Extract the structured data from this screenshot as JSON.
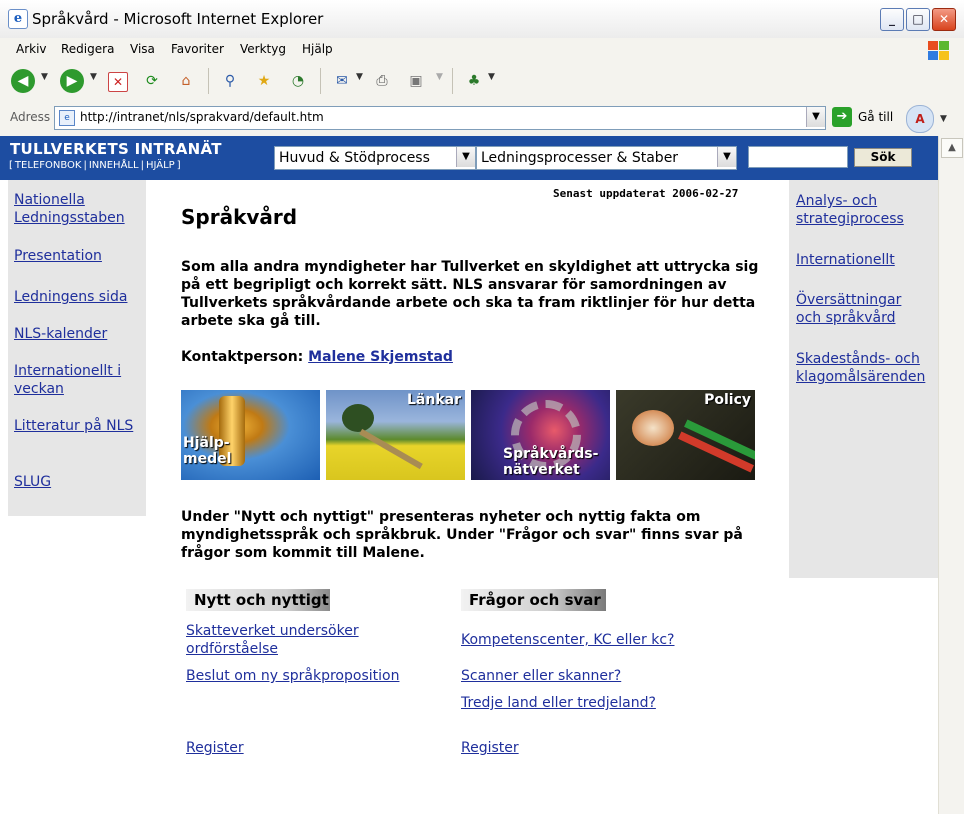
{
  "window": {
    "title": "Språkvård - Microsoft Internet Explorer",
    "controls": [
      "_",
      "□",
      "✕"
    ]
  },
  "menu": [
    "Arkiv",
    "Redigera",
    "Visa",
    "Favoriter",
    "Verktyg",
    "Hjälp"
  ],
  "toolbar": {
    "icons": [
      "back-icon",
      "forward-icon",
      "stop-icon",
      "refresh-icon",
      "home-icon",
      "search-icon",
      "favorites-icon",
      "history-icon",
      "mail-icon",
      "print-icon",
      "edit-icon",
      "messenger-icon"
    ]
  },
  "address": {
    "label": "Adress",
    "url": "http://intranet/nls/sprakvard/default.htm",
    "go_label": "Gå till"
  },
  "header": {
    "brand": "TULLVERKETS INTRANÄT",
    "links": [
      "TELEFONBOK",
      "INNEHÅLL",
      "HJÄLP"
    ],
    "bracket_open": "[",
    "bracket_close": "]",
    "divider": "|",
    "select1": "Huvud & Stödprocess",
    "select2": "Ledningsprocesser & Staber",
    "search_value": "",
    "search_button": "Sök"
  },
  "left_nav": [
    "Nationella Ledningsstaben",
    "Presentation",
    "Ledningens sida",
    "NLS-kalender",
    "Internationellt i veckan",
    "Litteratur på NLS",
    "SLUG"
  ],
  "right_nav": [
    "Analys- och strategiprocess",
    "Internationellt",
    "Översättningar och språkvård",
    "Skadestånds- och klagomålsärenden"
  ],
  "main": {
    "updated": "Senast uppdaterat 2006-02-27",
    "title": "Språkvård",
    "intro": "Som alla andra myndigheter har Tullverket en skyldighet att uttrycka sig på ett begripligt och korrekt sätt. NLS ansvarar för samordningen av Tullverkets språkvårdande arbete och ska ta fram riktlinjer för hur detta arbete ska gå till.",
    "contact_label": "Kontaktperson:",
    "contact_name": "Malene Skjemstad",
    "tiles": [
      {
        "caption": "Hjälp-\nmedel"
      },
      {
        "caption": "Länkar"
      },
      {
        "caption": "Språkvårds-\nnätverket"
      },
      {
        "caption": "Policy"
      }
    ],
    "info": "Under \"Nytt och nyttigt\" presenteras nyheter och nyttig fakta om myndighetsspråk och språkbruk. Under \"Frågor och svar\" finns svar på frågor som kommit till Malene.",
    "news": {
      "header": "Nytt och nyttigt",
      "links": [
        "Skatteverket undersöker ordförståelse",
        "Beslut om ny språkproposition"
      ],
      "register": "Register"
    },
    "faq": {
      "header": "Frågor och svar",
      "links": [
        "Kompetenscenter, KC eller kc?",
        "Scanner eller skanner?",
        "Tredje land eller tredjeland?"
      ],
      "register": "Register"
    }
  },
  "colors": {
    "header_blue": "#1d4da1",
    "nav_grey": "#e6e6e6",
    "link": "#1f2f9c"
  }
}
